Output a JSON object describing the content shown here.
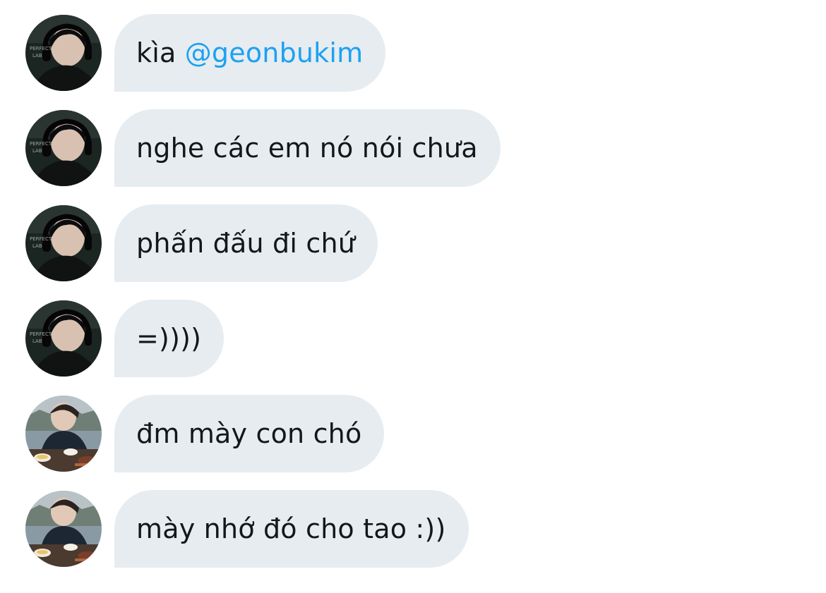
{
  "messages": [
    {
      "sender": "user-a",
      "text": "kìa",
      "mention": "@geonbukim"
    },
    {
      "sender": "user-a",
      "text": "nghe các em nó nói chưa"
    },
    {
      "sender": "user-a",
      "text": "phấn đấu đi chứ"
    },
    {
      "sender": "user-a",
      "text": "=))))"
    },
    {
      "sender": "user-b",
      "text": "đm mày con chó"
    },
    {
      "sender": "user-b",
      "text": "mày nhớ đó cho tao :))"
    }
  ],
  "colors": {
    "bubble_bg": "#e6ecf0",
    "text": "#14171a",
    "mention": "#1da1f2",
    "background": "#ffffff"
  },
  "icons": {
    "avatar_a": "avatar-gamer-headset-photo",
    "avatar_b": "avatar-dining-photo"
  }
}
